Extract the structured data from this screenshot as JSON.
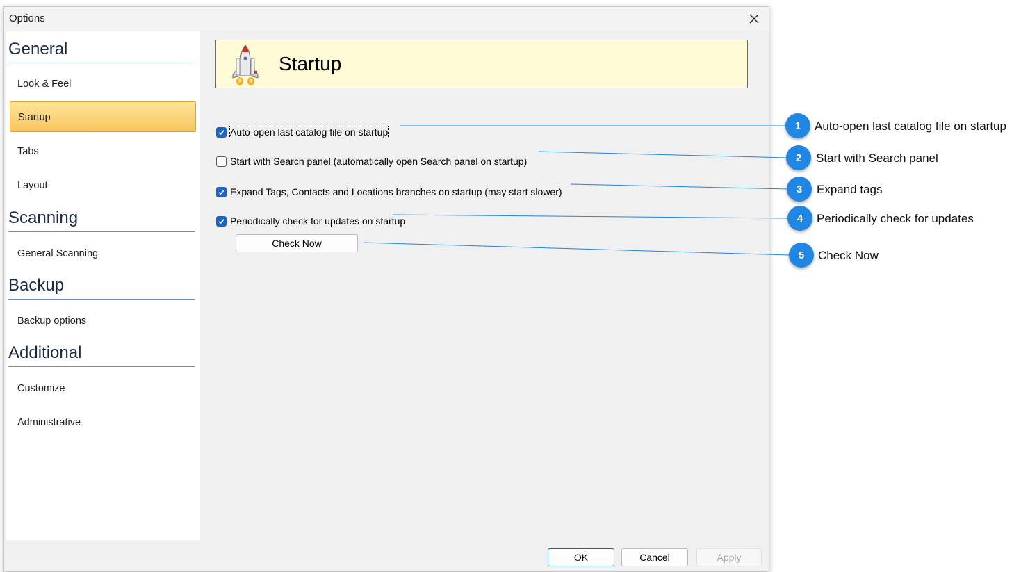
{
  "window": {
    "title": "Options"
  },
  "sidebar": {
    "sections": [
      {
        "heading": "General",
        "items": [
          "Look & Feel",
          "Startup",
          "Tabs",
          "Layout"
        ]
      },
      {
        "heading": "Scanning",
        "items": [
          "General Scanning"
        ]
      },
      {
        "heading": "Backup",
        "items": [
          "Backup options"
        ]
      },
      {
        "heading": "Additional",
        "items": [
          "Customize",
          "Administrative"
        ]
      }
    ],
    "selected": "Startup"
  },
  "page": {
    "title": "Startup",
    "icon": "rocket-icon",
    "options": [
      {
        "label": "Auto-open last catalog file on startup",
        "checked": true
      },
      {
        "label": "Start with Search panel (automatically open Search panel on startup)",
        "checked": false
      },
      {
        "label": "Expand Tags, Contacts and Locations branches on startup (may start slower)",
        "checked": true
      },
      {
        "label": "Periodically check for updates on startup",
        "checked": true
      }
    ],
    "check_now_label": "Check Now"
  },
  "footer": {
    "ok_label": "OK",
    "cancel_label": "Cancel",
    "apply_label": "Apply"
  },
  "callouts": [
    {
      "number": "1",
      "text": "Auto-open last catalog file on startup"
    },
    {
      "number": "2",
      "text": "Start with Search panel"
    },
    {
      "number": "3",
      "text": "Expand tags"
    },
    {
      "number": "4",
      "text": "Periodically check for updates"
    },
    {
      "number": "5",
      "text": "Check Now"
    }
  ],
  "colors": {
    "accent": "#1a66c8",
    "callout_badge": "#1f86e3",
    "selected_item": "#f8c75e",
    "header_bg": "#fefbd6"
  }
}
